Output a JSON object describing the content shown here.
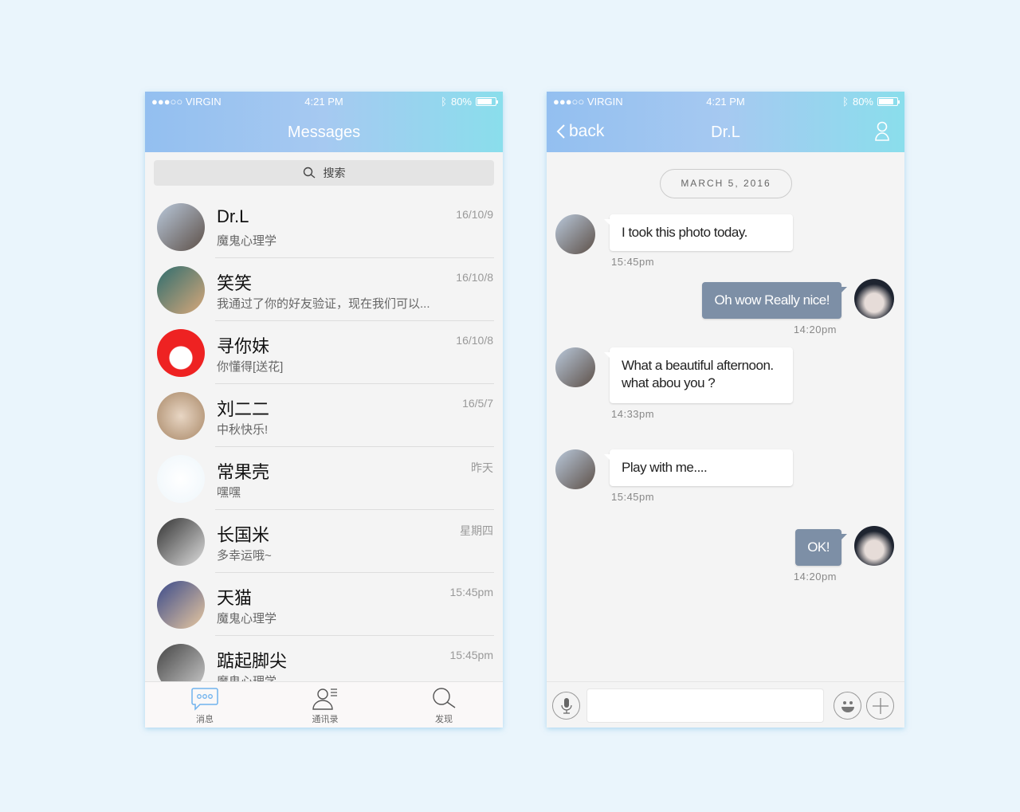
{
  "status": {
    "carrier": "●●●○○ VIRGIN",
    "time": "4:21 PM",
    "battery": "80%"
  },
  "messages_screen": {
    "title": "Messages",
    "search_placeholder": "搜索",
    "conversations": [
      {
        "name": "Dr.L",
        "preview": "魔鬼心理学",
        "time": "16/10/9"
      },
      {
        "name": "笑笑",
        "preview": "我通过了你的好友验证，现在我们可以...",
        "time": "16/10/8"
      },
      {
        "name": "寻你妹",
        "preview": "你懂得[送花]",
        "time": "16/10/8"
      },
      {
        "name": "刘二二",
        "preview": "中秋快乐!",
        "time": "16/5/7"
      },
      {
        "name": "常果壳",
        "preview": "嘿嘿",
        "time": "昨天"
      },
      {
        "name": "长国米",
        "preview": "多幸运哦~",
        "time": "星期四"
      },
      {
        "name": "天猫",
        "preview": "魔鬼心理学",
        "time": "15:45pm"
      },
      {
        "name": "踮起脚尖",
        "preview": "魔鬼心理学",
        "time": "15:45pm"
      }
    ],
    "tabs": [
      {
        "label": "消息",
        "icon": "chat-bubble-icon",
        "active": true
      },
      {
        "label": "通讯录",
        "icon": "contacts-icon"
      },
      {
        "label": "发现",
        "icon": "search-icon"
      }
    ]
  },
  "chat_screen": {
    "back_label": "back",
    "title": "Dr.L",
    "date": "MARCH 5, 2016",
    "messages": [
      {
        "dir": "in",
        "text": "I took this photo today.",
        "time": "15:45pm"
      },
      {
        "dir": "out",
        "text": "Oh wow Really nice!",
        "time": "14:20pm"
      },
      {
        "dir": "in",
        "text": "What a beautiful afternoon.\nwhat abou you ?",
        "time": "14:33pm"
      },
      {
        "dir": "in",
        "text": "Play with me....",
        "time": "15:45pm"
      },
      {
        "dir": "out",
        "text": "OK!",
        "time": "14:20pm"
      }
    ]
  },
  "colors": {
    "header_start": "#93bff0",
    "header_end": "#8adeec",
    "sent_bubble": "#7d8fa6",
    "tab_active": "#6fb2ee"
  }
}
